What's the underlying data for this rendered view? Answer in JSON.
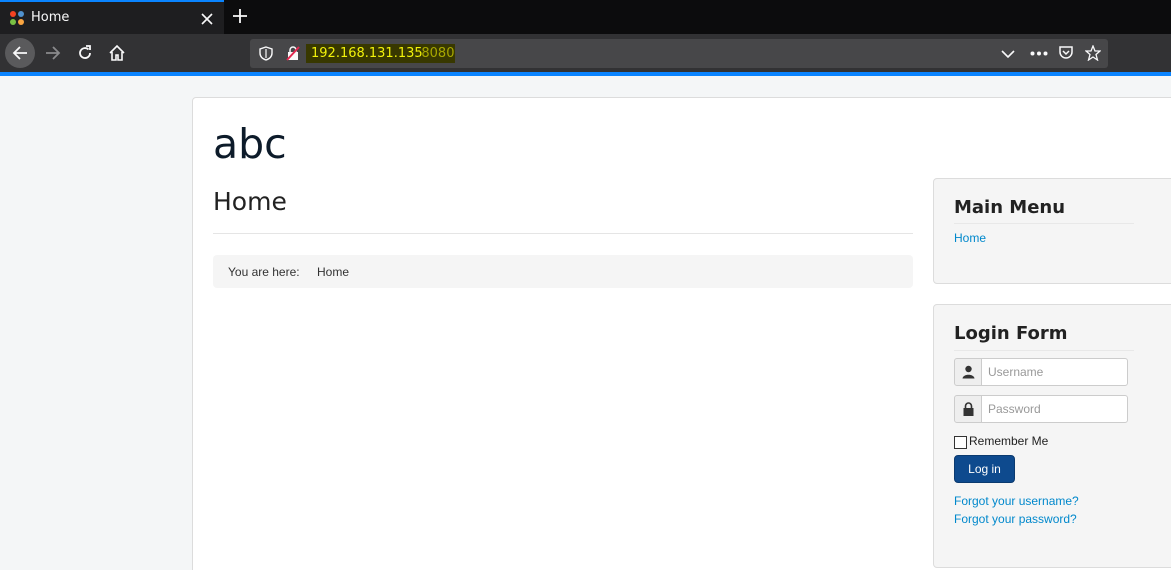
{
  "browser": {
    "tab_title": "Home",
    "url_host": "192.168.131.135",
    "url_port": ":8080"
  },
  "site": {
    "title": "abc",
    "page_heading": "Home",
    "breadcrumb": {
      "label": "You are here:",
      "item": "Home"
    }
  },
  "main_menu": {
    "title": "Main Menu",
    "items": [
      "Home"
    ]
  },
  "login_form": {
    "title": "Login Form",
    "username_placeholder": "Username",
    "password_placeholder": "Password",
    "remember_label": "Remember Me",
    "login_button": "Log in",
    "forgot_username": "Forgot your username?",
    "forgot_password": "Forgot your password?"
  }
}
